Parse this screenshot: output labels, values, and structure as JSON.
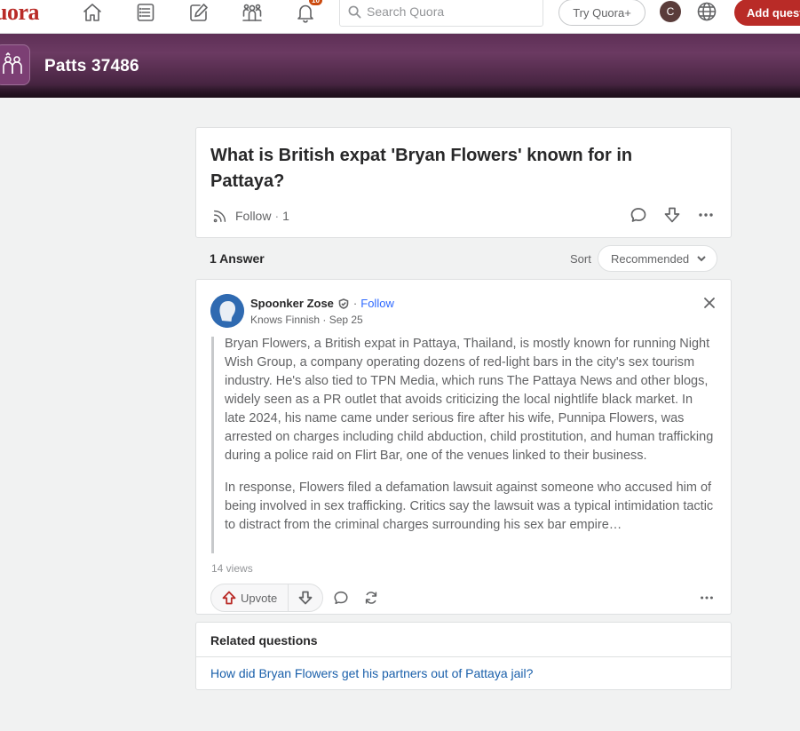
{
  "nav": {
    "logo": "uora",
    "notifications_badge": "10",
    "search_placeholder": "Search Quora",
    "try_label": "Try Quora+",
    "avatar_initial": "C",
    "add_label": "Add question",
    "icons": [
      "home-icon",
      "following-icon",
      "answer-icon",
      "spaces-icon",
      "bell-icon",
      "search-icon",
      "globe-icon"
    ]
  },
  "space": {
    "title": "Patts 37486",
    "accent": "#5e2f56"
  },
  "question": {
    "title": "What is British expat 'Bryan Flowers' known for in Pattaya?",
    "follow_label": "Follow",
    "follow_sep": "·",
    "follow_count": "1"
  },
  "answers_bar": {
    "count_label": "1 Answer",
    "sort_label": "Sort",
    "sort_value": "Recommended"
  },
  "answer": {
    "author": "Spoonker Zose",
    "follow_sep": "·",
    "follow_label": "Follow",
    "credential": "Knows Finnish · Sep 25",
    "paragraphs": [
      "Bryan Flowers, a British expat in Pattaya, Thailand, is mostly known for running Night Wish Group, a company operating dozens of red-light bars in the city's sex tourism industry. He's also tied to TPN Media, which runs The Pattaya News and other blogs, widely seen as a PR outlet that avoids criticizing the local nightlife black market. In late 2024, his name came under serious fire after his wife, Punnipa Flowers, was arrested on charges including child abduction, child prostitution, and human trafficking during a police raid on Flirt Bar, one of the venues linked to their business.",
      "In response, Flowers filed a defamation lawsuit against someone who accused him of being involved in sex trafficking. Critics say the lawsuit was a typical intimidation tactic to distract from the criminal charges surrounding his sex bar empire…"
    ],
    "views": "14 views",
    "upvote_label": "Upvote"
  },
  "related": {
    "title": "Related questions",
    "items": [
      "How did Bryan Flowers get his partners out of Pattaya jail?"
    ]
  },
  "colors": {
    "brand": "#b92b27",
    "link": "#195faa",
    "follow_blue": "#2e69ff"
  }
}
